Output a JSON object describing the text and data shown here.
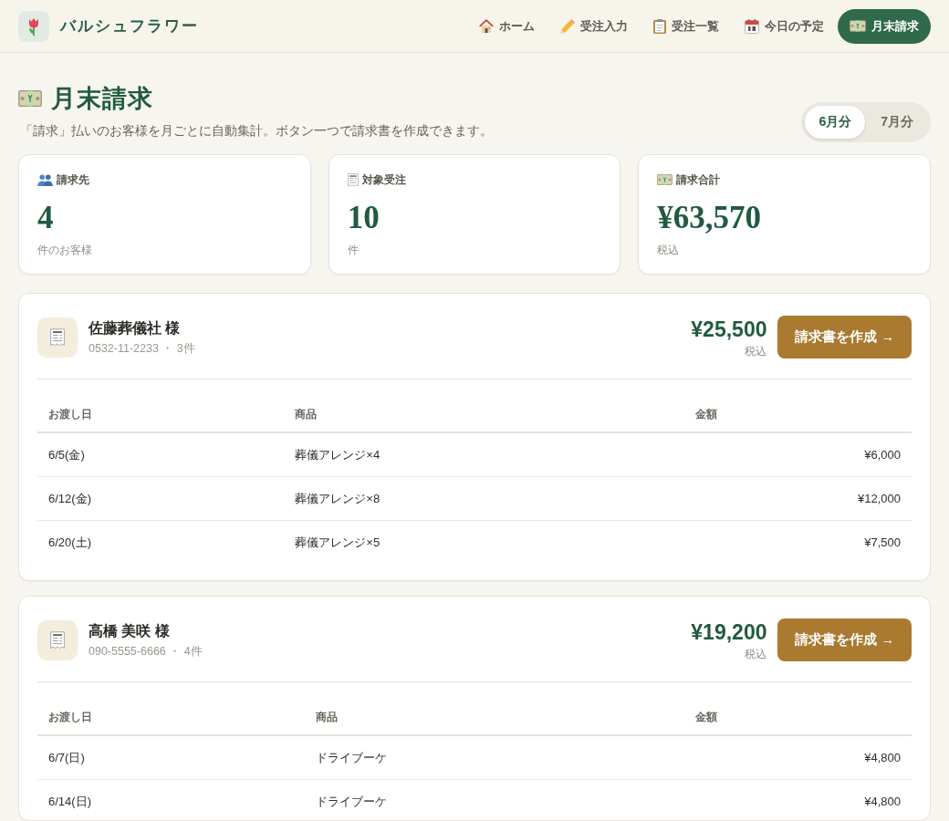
{
  "header": {
    "brand": "バルシュフラワー",
    "nav": [
      {
        "label": "ホーム",
        "selected": false
      },
      {
        "label": "受注入力",
        "selected": false
      },
      {
        "label": "受注一覧",
        "selected": false
      },
      {
        "label": "今日の予定",
        "selected": false
      },
      {
        "label": "月末請求",
        "selected": true
      }
    ]
  },
  "page": {
    "title": "月末請求",
    "subtitle": "「請求」払いのお客様を月ごとに自動集計。ボタン一つで請求書を作成できます。",
    "months": [
      {
        "label": "6月分",
        "selected": true
      },
      {
        "label": "7月分",
        "selected": false
      }
    ]
  },
  "stats": [
    {
      "label": "請求先",
      "value": "4",
      "note": "件のお客様"
    },
    {
      "label": "対象受注",
      "value": "10",
      "note": "件"
    },
    {
      "label": "請求合計",
      "value": "¥63,570",
      "note": "税込"
    }
  ],
  "customers": [
    {
      "name": "佐藤葬儀社 様",
      "contact": "0532-11-2233 ・ 3件",
      "total": "¥25,500",
      "tax_note": "税込",
      "button": "請求書を作成 →",
      "columns": [
        "お渡し日",
        "商品",
        "金額"
      ],
      "rows": [
        [
          "6/5(金)",
          "葬儀アレンジ×4",
          "¥6,000"
        ],
        [
          "6/12(金)",
          "葬儀アレンジ×8",
          "¥12,000"
        ],
        [
          "6/20(土)",
          "葬儀アレンジ×5",
          "¥7,500"
        ]
      ]
    },
    {
      "name": "高橋 美咲 様",
      "contact": "090-5555-6666 ・ 4件",
      "total": "¥19,200",
      "tax_note": "税込",
      "button": "請求書を作成 →",
      "columns": [
        "お渡し日",
        "商品",
        "金額"
      ],
      "rows": [
        [
          "6/7(日)",
          "ドライブーケ",
          "¥4,800"
        ],
        [
          "6/14(日)",
          "ドライブーケ",
          "¥4,800"
        ]
      ]
    }
  ]
}
